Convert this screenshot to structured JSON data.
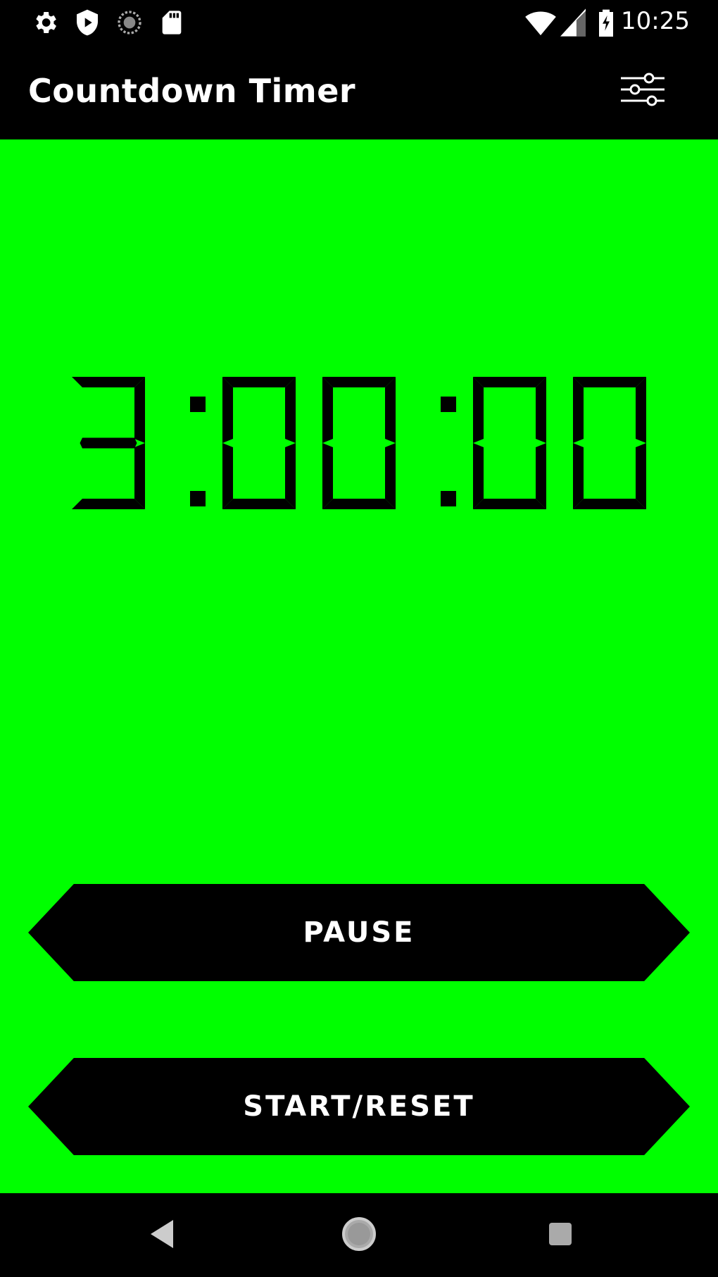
{
  "status_bar": {
    "time": "10:25",
    "icons": [
      "gear-icon",
      "shield-play-icon",
      "sync-icon",
      "sd-card-icon",
      "wifi-icon",
      "cell-signal-icon",
      "battery-charging-icon"
    ]
  },
  "app_bar": {
    "title": "Countdown Timer",
    "settings_icon": "sliders-icon"
  },
  "timer": {
    "display": "3:00:00"
  },
  "buttons": {
    "pause": "PAUSE",
    "start_reset": "START/RESET"
  },
  "nav_bar": {
    "icons": [
      "back-icon",
      "home-icon",
      "recents-icon"
    ]
  },
  "colors": {
    "background": "#00ff00",
    "bars": "#000000",
    "text": "#ffffff"
  }
}
